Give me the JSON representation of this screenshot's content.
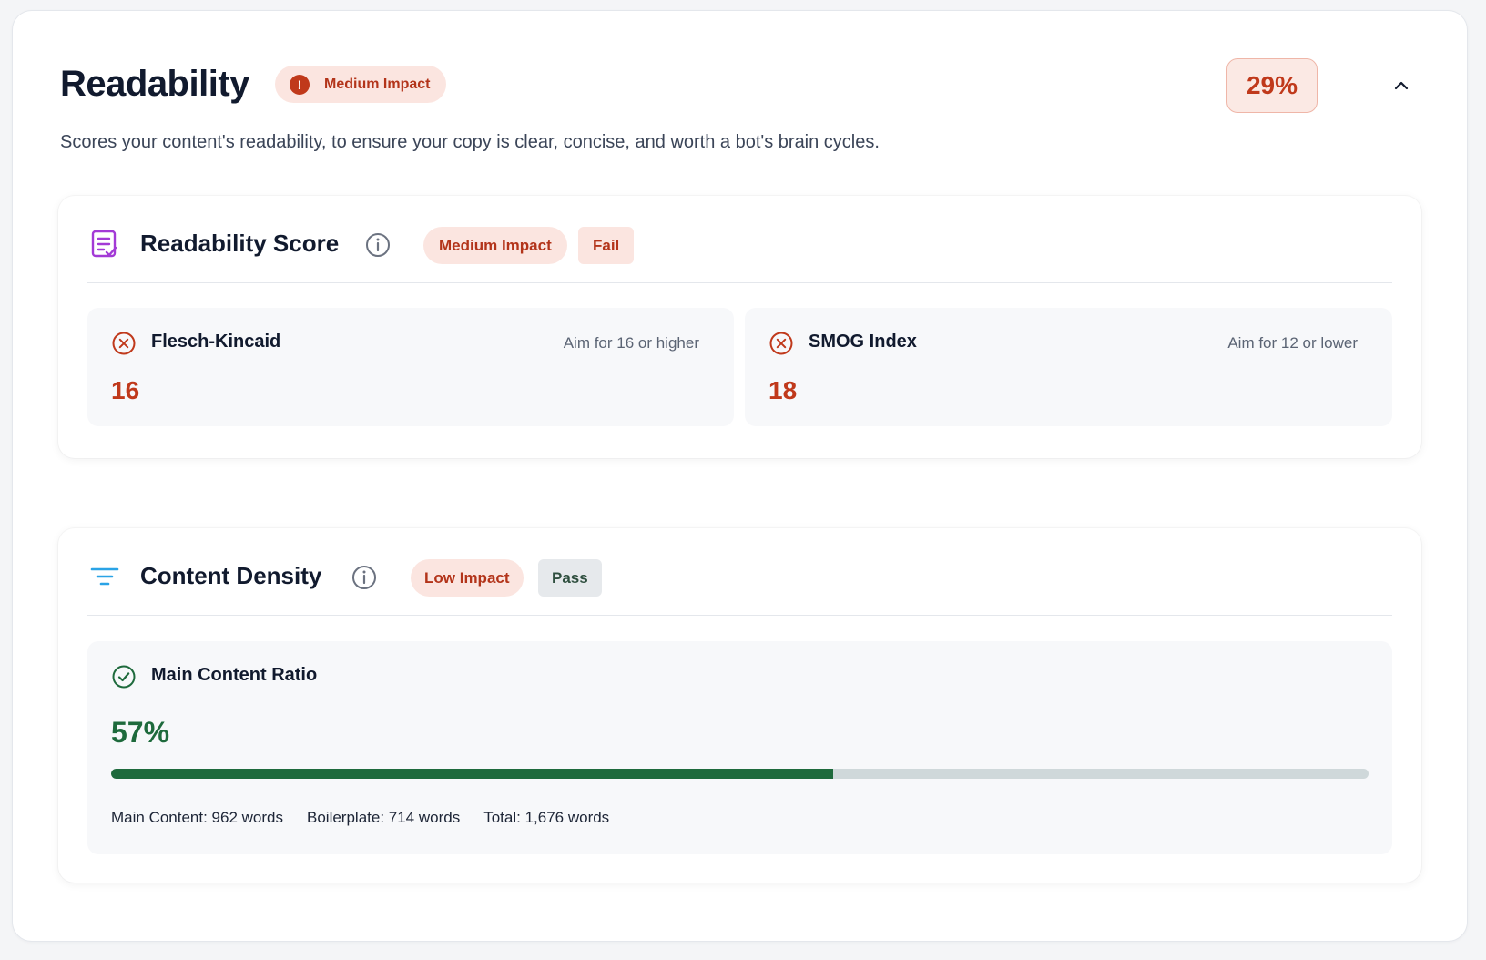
{
  "header": {
    "title": "Readability",
    "impact_label": "Medium Impact",
    "score": "29%",
    "description": "Scores your content's readability, to ensure your copy is clear, concise, and worth a bot's brain cycles."
  },
  "readability_score": {
    "title": "Readability Score",
    "impact_label": "Medium Impact",
    "status_label": "Fail",
    "metrics": [
      {
        "name": "Flesch-Kincaid",
        "aim": "Aim for 16 or higher",
        "value": "16",
        "status": "fail"
      },
      {
        "name": "SMOG Index",
        "aim": "Aim for 12 or lower",
        "value": "18",
        "status": "fail"
      }
    ]
  },
  "content_density": {
    "title": "Content Density",
    "impact_label": "Low Impact",
    "status_label": "Pass",
    "metric": {
      "name": "Main Content Ratio",
      "value": "57%",
      "progress_fraction": 0.574,
      "main_content": "Main Content: 962 words",
      "boilerplate": "Boilerplate: 714 words",
      "total": "Total: 1,676 words"
    }
  },
  "icons": {
    "alert": "alert-circle-icon",
    "collapse": "chevron-up-icon",
    "readability_section": "document-check-icon",
    "density_section": "filter-lines-icon",
    "info": "info-icon",
    "fail": "x-circle-icon",
    "pass": "check-circle-icon"
  },
  "colors": {
    "fail": "#c0391b",
    "fail_bg": "#fbe5e0",
    "pass": "#1e6a3c",
    "track": "#cfd8da",
    "accent_purple": "#a33ad6",
    "accent_blue": "#2aa3e6"
  }
}
